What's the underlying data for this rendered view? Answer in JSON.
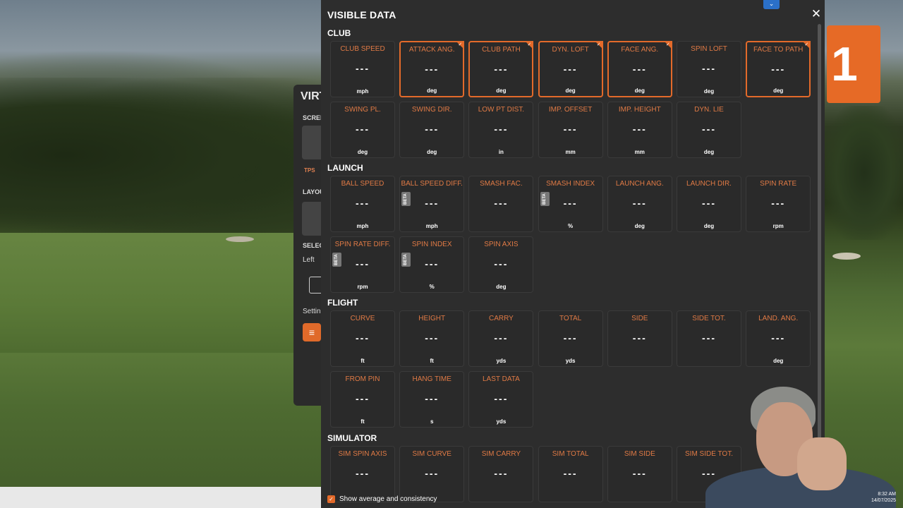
{
  "window": {
    "title": "VISIBLE DATA",
    "close_icon": "close-icon",
    "top_tab_icon": "chevron-down-icon"
  },
  "background_panel": {
    "title": "VIRT",
    "screen_label": "SCREE",
    "tps": "TPS",
    "layout_label": "LAYOU",
    "select_label": "SELEC",
    "left": "Left",
    "settings": "Settin"
  },
  "big_tile": "1",
  "dash": "---",
  "sections": [
    {
      "title": "CLUB",
      "tiles": [
        {
          "label": "CLUB SPEED",
          "unit": "mph",
          "selected": false,
          "beta": false
        },
        {
          "label": "ATTACK ANG.",
          "unit": "deg",
          "selected": true,
          "beta": false
        },
        {
          "label": "CLUB PATH",
          "unit": "deg",
          "selected": true,
          "beta": false
        },
        {
          "label": "DYN. LOFT",
          "unit": "deg",
          "selected": true,
          "beta": false
        },
        {
          "label": "FACE ANG.",
          "unit": "deg",
          "selected": true,
          "beta": false
        },
        {
          "label": "SPIN LOFT",
          "unit": "deg",
          "selected": false,
          "beta": false
        },
        {
          "label": "FACE TO PATH",
          "unit": "deg",
          "selected": true,
          "beta": false
        },
        {
          "label": "SWING PL.",
          "unit": "deg",
          "selected": false,
          "beta": false
        },
        {
          "label": "SWING DIR.",
          "unit": "deg",
          "selected": false,
          "beta": false
        },
        {
          "label": "LOW PT DIST.",
          "unit": "in",
          "selected": false,
          "beta": false
        },
        {
          "label": "IMP. OFFSET",
          "unit": "mm",
          "selected": false,
          "beta": false
        },
        {
          "label": "IMP. HEIGHT",
          "unit": "mm",
          "selected": false,
          "beta": false
        },
        {
          "label": "DYN. LIE",
          "unit": "deg",
          "selected": false,
          "beta": false
        }
      ]
    },
    {
      "title": "LAUNCH",
      "tiles": [
        {
          "label": "BALL SPEED",
          "unit": "mph",
          "selected": false,
          "beta": false
        },
        {
          "label": "BALL SPEED DIFF.",
          "unit": "mph",
          "selected": false,
          "beta": true
        },
        {
          "label": "SMASH FAC.",
          "unit": "",
          "selected": false,
          "beta": false
        },
        {
          "label": "SMASH INDEX",
          "unit": "%",
          "selected": false,
          "beta": true
        },
        {
          "label": "LAUNCH ANG.",
          "unit": "deg",
          "selected": false,
          "beta": false
        },
        {
          "label": "LAUNCH DIR.",
          "unit": "deg",
          "selected": false,
          "beta": false
        },
        {
          "label": "SPIN RATE",
          "unit": "rpm",
          "selected": false,
          "beta": false
        },
        {
          "label": "SPIN RATE DIFF.",
          "unit": "rpm",
          "selected": false,
          "beta": true
        },
        {
          "label": "SPIN INDEX",
          "unit": "%",
          "selected": false,
          "beta": true
        },
        {
          "label": "SPIN AXIS",
          "unit": "deg",
          "selected": false,
          "beta": false
        }
      ]
    },
    {
      "title": "FLIGHT",
      "tiles": [
        {
          "label": "CURVE",
          "unit": "ft",
          "selected": false,
          "beta": false
        },
        {
          "label": "HEIGHT",
          "unit": "ft",
          "selected": false,
          "beta": false
        },
        {
          "label": "CARRY",
          "unit": "yds",
          "selected": false,
          "beta": false
        },
        {
          "label": "TOTAL",
          "unit": "yds",
          "selected": false,
          "beta": false
        },
        {
          "label": "SIDE",
          "unit": "",
          "selected": false,
          "beta": false
        },
        {
          "label": "SIDE TOT.",
          "unit": "",
          "selected": false,
          "beta": false
        },
        {
          "label": "LAND. ANG.",
          "unit": "deg",
          "selected": false,
          "beta": false
        },
        {
          "label": "FROM PIN",
          "unit": "ft",
          "selected": false,
          "beta": false
        },
        {
          "label": "HANG TIME",
          "unit": "s",
          "selected": false,
          "beta": false
        },
        {
          "label": "LAST DATA",
          "unit": "yds",
          "selected": false,
          "beta": false
        }
      ]
    },
    {
      "title": "SIMULATOR",
      "tiles": [
        {
          "label": "SIM SPIN AXIS",
          "unit": "",
          "selected": false,
          "beta": false
        },
        {
          "label": "SIM CURVE",
          "unit": "",
          "selected": false,
          "beta": false
        },
        {
          "label": "SIM CARRY",
          "unit": "",
          "selected": false,
          "beta": false
        },
        {
          "label": "SIM TOTAL",
          "unit": "",
          "selected": false,
          "beta": false
        },
        {
          "label": "SIM SIDE",
          "unit": "",
          "selected": false,
          "beta": false
        },
        {
          "label": "SIM SIDE TOT.",
          "unit": "",
          "selected": false,
          "beta": false
        }
      ]
    }
  ],
  "beta_label": "BETA",
  "footer": {
    "checkbox_checked": true,
    "label": "Show average and consistency"
  },
  "clock": {
    "time": "8:32 AM",
    "date": "14/07/2025"
  },
  "colors": {
    "accent": "#e36a2a",
    "label": "#e07a45",
    "panel": "#2d2d2d"
  }
}
